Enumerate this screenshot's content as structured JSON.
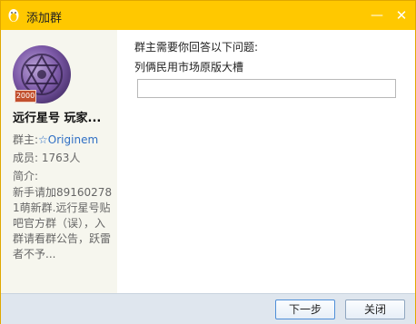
{
  "window": {
    "title": "添加群",
    "minimize_symbol": "—",
    "close_symbol": "✕"
  },
  "sidebar": {
    "avatar_badge": "2000",
    "group_name": "远行星号 玩家...",
    "owner_label": "群主:",
    "owner_name": "☆Originem",
    "members": "成员: 1763人",
    "intro_label": "简介:",
    "intro_text": "新手请加891602781萌新群.远行星号贴吧官方群（误），入群请看群公告，跃雷者不予..."
  },
  "main": {
    "question_label": "群主需要你回答以下问题:",
    "question_text": "列俩民用市场原版大槽",
    "answer_value": "",
    "answer_placeholder": ""
  },
  "footer": {
    "next_label": "下一步",
    "close_label": "关闭"
  },
  "colors": {
    "titlebar": "#ffc800",
    "sidebar_bg": "#f6f6ee",
    "footer_bg": "#dfe6ee",
    "link": "#2f6fc4"
  }
}
